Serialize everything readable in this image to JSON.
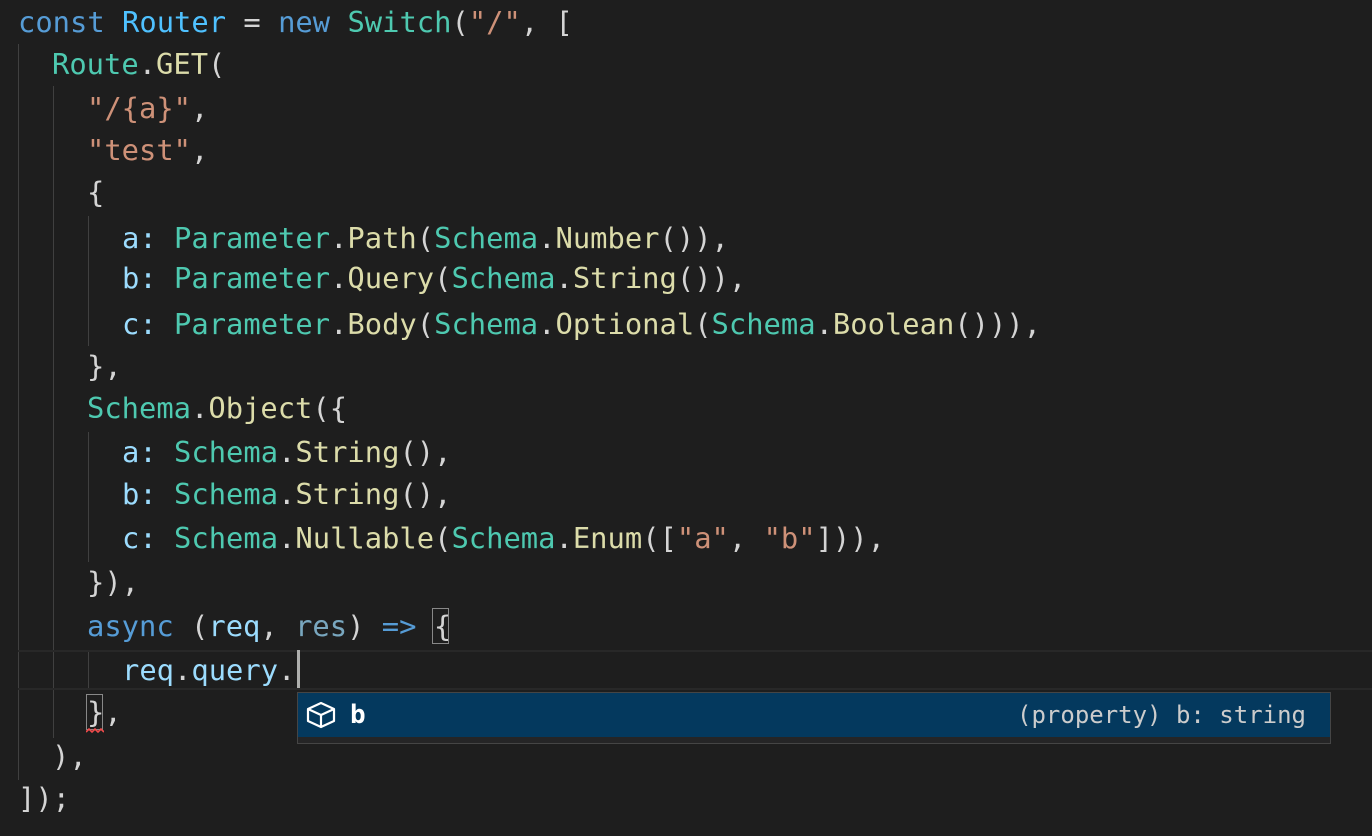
{
  "theme": {
    "background": "#1e1e1e",
    "keyword_color": "#569cd6",
    "class_color": "#4ec9b0",
    "function_color": "#dcdcaa",
    "string_color": "#ce9178",
    "variable_color": "#9cdcfe",
    "suggest_selected_background": "#04395e"
  },
  "code": {
    "line1": {
      "const_kw": "const",
      "router": "Router",
      "eq": " = ",
      "new_kw": "new",
      "switch_cls": "Switch",
      "open": "(",
      "path_str": "\"/\"",
      "rest": ", ["
    },
    "line2": {
      "route": "Route",
      "dot": ".",
      "get": "GET",
      "open": "("
    },
    "line3": {
      "str": "\"/{a}\"",
      "comma": ","
    },
    "line4": {
      "str": "\"test\"",
      "comma": ","
    },
    "line5": {
      "brace": "{"
    },
    "line6": {
      "key": "a:",
      "param": "Parameter",
      "dot1": ".",
      "method": "Path",
      "open1": "(",
      "schema": "Schema",
      "dot2": ".",
      "type": "Number",
      "close": "()),"
    },
    "line7": {
      "key": "b:",
      "param": "Parameter",
      "dot1": ".",
      "method": "Query",
      "open1": "(",
      "schema": "Schema",
      "dot2": ".",
      "type": "String",
      "close": "()),"
    },
    "line8": {
      "key": "c:",
      "param": "Parameter",
      "dot1": ".",
      "method": "Body",
      "open1": "(",
      "schema1": "Schema",
      "dot2": ".",
      "type1": "Optional",
      "open2": "(",
      "schema2": "Schema",
      "dot3": ".",
      "type2": "Boolean",
      "close": "())),"
    },
    "line9": {
      "text": "},"
    },
    "line10": {
      "schema": "Schema",
      "dot": ".",
      "method": "Object",
      "open": "({"
    },
    "line11": {
      "key": "a:",
      "schema": "Schema",
      "dot": ".",
      "type": "String",
      "close": "(),"
    },
    "line12": {
      "key": "b:",
      "schema": "Schema",
      "dot": ".",
      "type": "String",
      "close": "(),"
    },
    "line13": {
      "key": "c:",
      "schema1": "Schema",
      "dot1": ".",
      "type1": "Nullable",
      "open1": "(",
      "schema2": "Schema",
      "dot2": ".",
      "type2": "Enum",
      "open2": "([",
      "str_a": "\"a\"",
      "comma": ", ",
      "str_b": "\"b\"",
      "close": "])),"
    },
    "line14": {
      "text": "}),"
    },
    "line15": {
      "async_kw": "async",
      "open": " (",
      "req": "req",
      "comma": ", ",
      "res": "res",
      "close": ") ",
      "arrow": "=>",
      "space": " ",
      "brace": "{"
    },
    "line16": {
      "req": "req",
      "dot1": ".",
      "query": "query",
      "dot2": "."
    },
    "line17": {
      "brace": "}",
      "comma": ","
    },
    "line18": {
      "text": "),"
    },
    "line19": {
      "text": "]);"
    }
  },
  "suggest": {
    "icon": "property-icon",
    "label": "b",
    "detail": "(property) b: string"
  }
}
